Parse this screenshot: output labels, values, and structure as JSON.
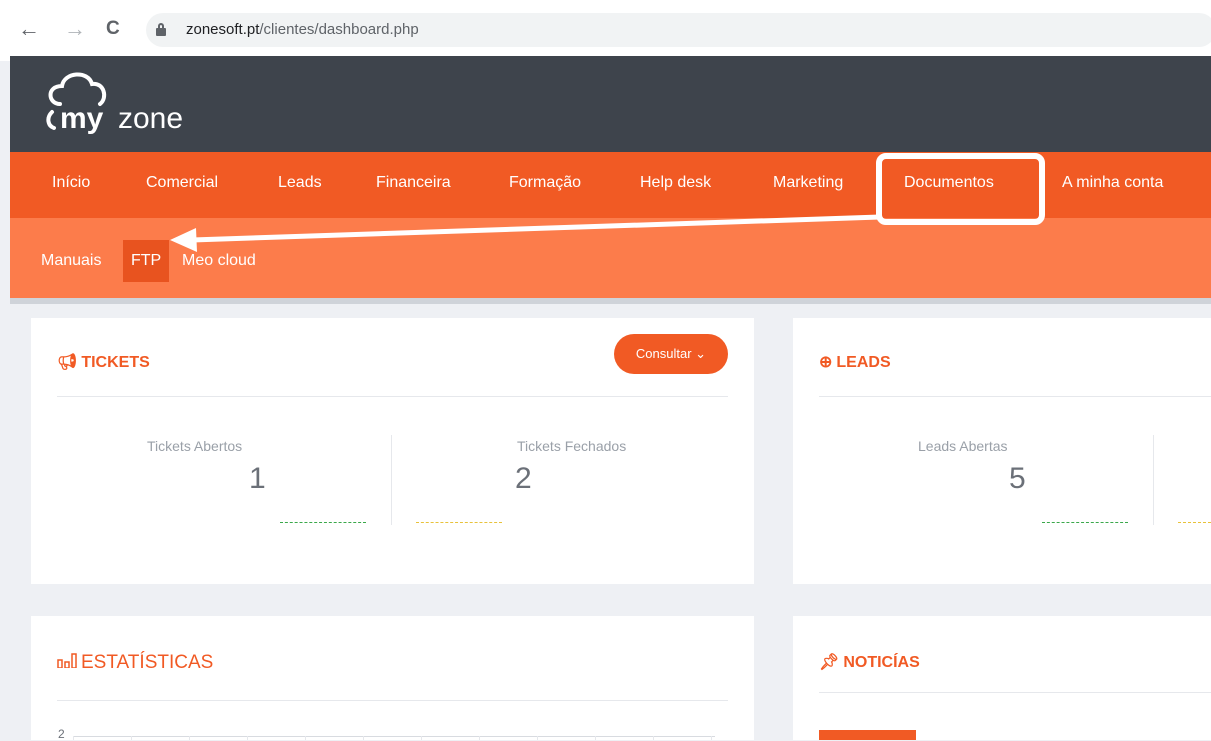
{
  "browser": {
    "url_domain": "zonesoft.pt",
    "url_path": "/clientes/dashboard.php",
    "back_icon": "←",
    "forward_icon": "→",
    "reload_icon": "C"
  },
  "logo": {
    "my": "my",
    "zone": "zone"
  },
  "main_nav": [
    "Início",
    "Comercial",
    "Leads",
    "Financeira",
    "Formação",
    "Help desk",
    "Marketing",
    "Documentos",
    "A minha conta"
  ],
  "sub_nav": [
    "Manuais",
    "FTP",
    "Meo cloud"
  ],
  "tickets": {
    "title": "TICKETS",
    "button": "Consultar ⌄",
    "open_label": "Tickets Abertos",
    "open_value": "1",
    "closed_label": "Tickets Fechados",
    "closed_value": "2"
  },
  "leads": {
    "title": "LEADS",
    "open_label": "Leads Abertas",
    "open_value": "5"
  },
  "stats": {
    "title": "ESTATÍSTICAS",
    "y_tick": "2"
  },
  "news": {
    "title": "NOTICÍAS"
  },
  "colors": {
    "brand": "#f15a24",
    "header": "#3e444c",
    "subnav": "#fc7c4b"
  }
}
